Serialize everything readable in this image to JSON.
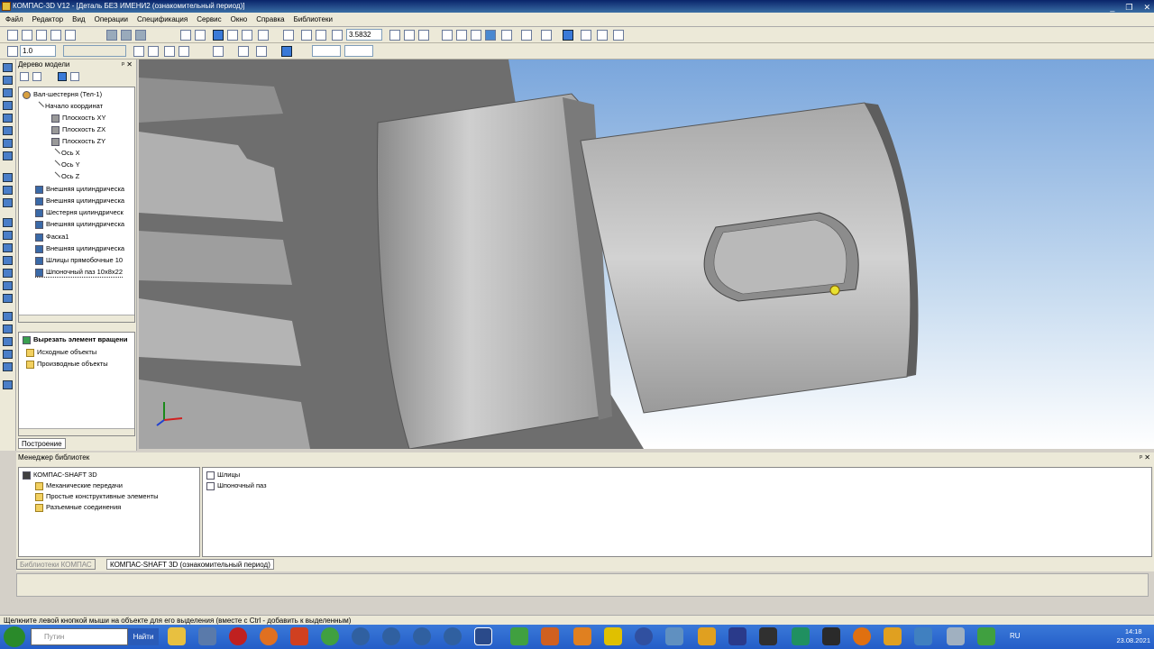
{
  "window": {
    "title": "КОМПАС-3D V12 - [Деталь БЕЗ ИМЕНИ2 (ознакомительный период)]",
    "controls": [
      "_",
      "❐",
      "✕"
    ]
  },
  "menu": [
    "Файл",
    "Редактор",
    "Вид",
    "Операции",
    "Спецификация",
    "Сервис",
    "Окно",
    "Справка",
    "Библиотеки"
  ],
  "toolbar": {
    "zoom_value": "3.5832",
    "step_value": "1.0"
  },
  "tree_panel": {
    "title": "Дерево модели",
    "pin": "ᵖ",
    "close": "✕",
    "nodes": [
      {
        "label": "Вал-шестерня (Тел-1)",
        "icon": "gear-icon"
      },
      {
        "label": "Начало координат",
        "icon": "origin-icon"
      },
      {
        "label": "Плоскость XY",
        "icon": "plane-icon"
      },
      {
        "label": "Плоскость ZX",
        "icon": "plane-icon"
      },
      {
        "label": "Плоскость ZY",
        "icon": "plane-icon"
      },
      {
        "label": "Ось X",
        "icon": "axis-icon"
      },
      {
        "label": "Ось Y",
        "icon": "axis-icon"
      },
      {
        "label": "Ось Z",
        "icon": "axis-icon"
      },
      {
        "label": "Внешняя цилиндрическа",
        "icon": "feature-icon"
      },
      {
        "label": "Внешняя цилиндрическа",
        "icon": "feature-icon"
      },
      {
        "label": "Шестерня цилиндрическ",
        "icon": "feature-icon"
      },
      {
        "label": "Внешняя цилиндрическа",
        "icon": "feature-icon"
      },
      {
        "label": "Фаска1",
        "icon": "chamfer-icon"
      },
      {
        "label": "Внешняя цилиндрическа",
        "icon": "feature-icon"
      },
      {
        "label": "Шлицы прямобочные 10",
        "icon": "feature-icon"
      },
      {
        "label": "Шпоночный паз 10х8х22",
        "icon": "feature-icon"
      }
    ],
    "lower_title": "Вырезать элемент вращени",
    "lower_nodes": [
      "Исходные объекты",
      "Производные объекты"
    ],
    "tab": "Построение"
  },
  "library_manager": {
    "title": "Менеджер библиотек",
    "root": "КОМПАС-SHAFT 3D",
    "folders": [
      "Механические передачи",
      "Простые конструктивные элементы",
      "Разъемные соединения"
    ],
    "items": [
      "Шлицы",
      "Шпоночный паз"
    ],
    "tabs": [
      "Библиотеки КОМПАС",
      "КОМПАС-SHAFT 3D (ознакомительный период)"
    ]
  },
  "status_text": "Щелкните левой кнопкой мыши на объекте для его выделения (вместе с Ctrl - добавить к выделенным)",
  "taskbar": {
    "search_placeholder": "Путин",
    "find_label": "Найти",
    "lang": "RU",
    "time": "14:18",
    "date": "23.08.2021"
  },
  "colors": {
    "accent": "#316ac5",
    "viewport_sky": "#8fb4e0",
    "model_gray": "#9a9a9a"
  }
}
